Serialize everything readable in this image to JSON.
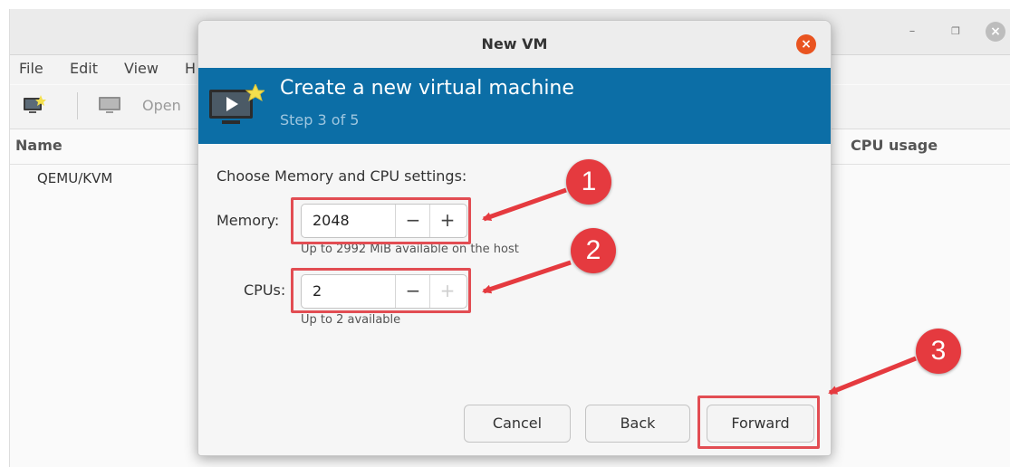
{
  "main_window": {
    "menu": [
      "File",
      "Edit",
      "View",
      "H"
    ],
    "toolbar": {
      "open_label": "Open"
    },
    "columns": {
      "name": "Name",
      "cpu_usage": "CPU usage"
    },
    "connections": [
      "QEMU/KVM"
    ]
  },
  "dialog": {
    "title": "New VM",
    "banner": {
      "title": "Create a new virtual machine",
      "subtitle": "Step 3 of 5"
    },
    "heading": "Choose Memory and CPU settings:",
    "memory": {
      "label": "Memory:",
      "value": "2048",
      "hint": "Up to 2992 MiB available on the host"
    },
    "cpus": {
      "label": "CPUs:",
      "value": "2",
      "hint": "Up to 2 available"
    },
    "buttons": {
      "cancel": "Cancel",
      "back": "Back",
      "forward": "Forward"
    }
  },
  "annotations": {
    "badges": [
      "1",
      "2",
      "3"
    ],
    "color": "#e53a3f"
  },
  "colors": {
    "banner": "#0c6ea6",
    "close_button": "#e95420",
    "highlight": "#e24d53"
  }
}
